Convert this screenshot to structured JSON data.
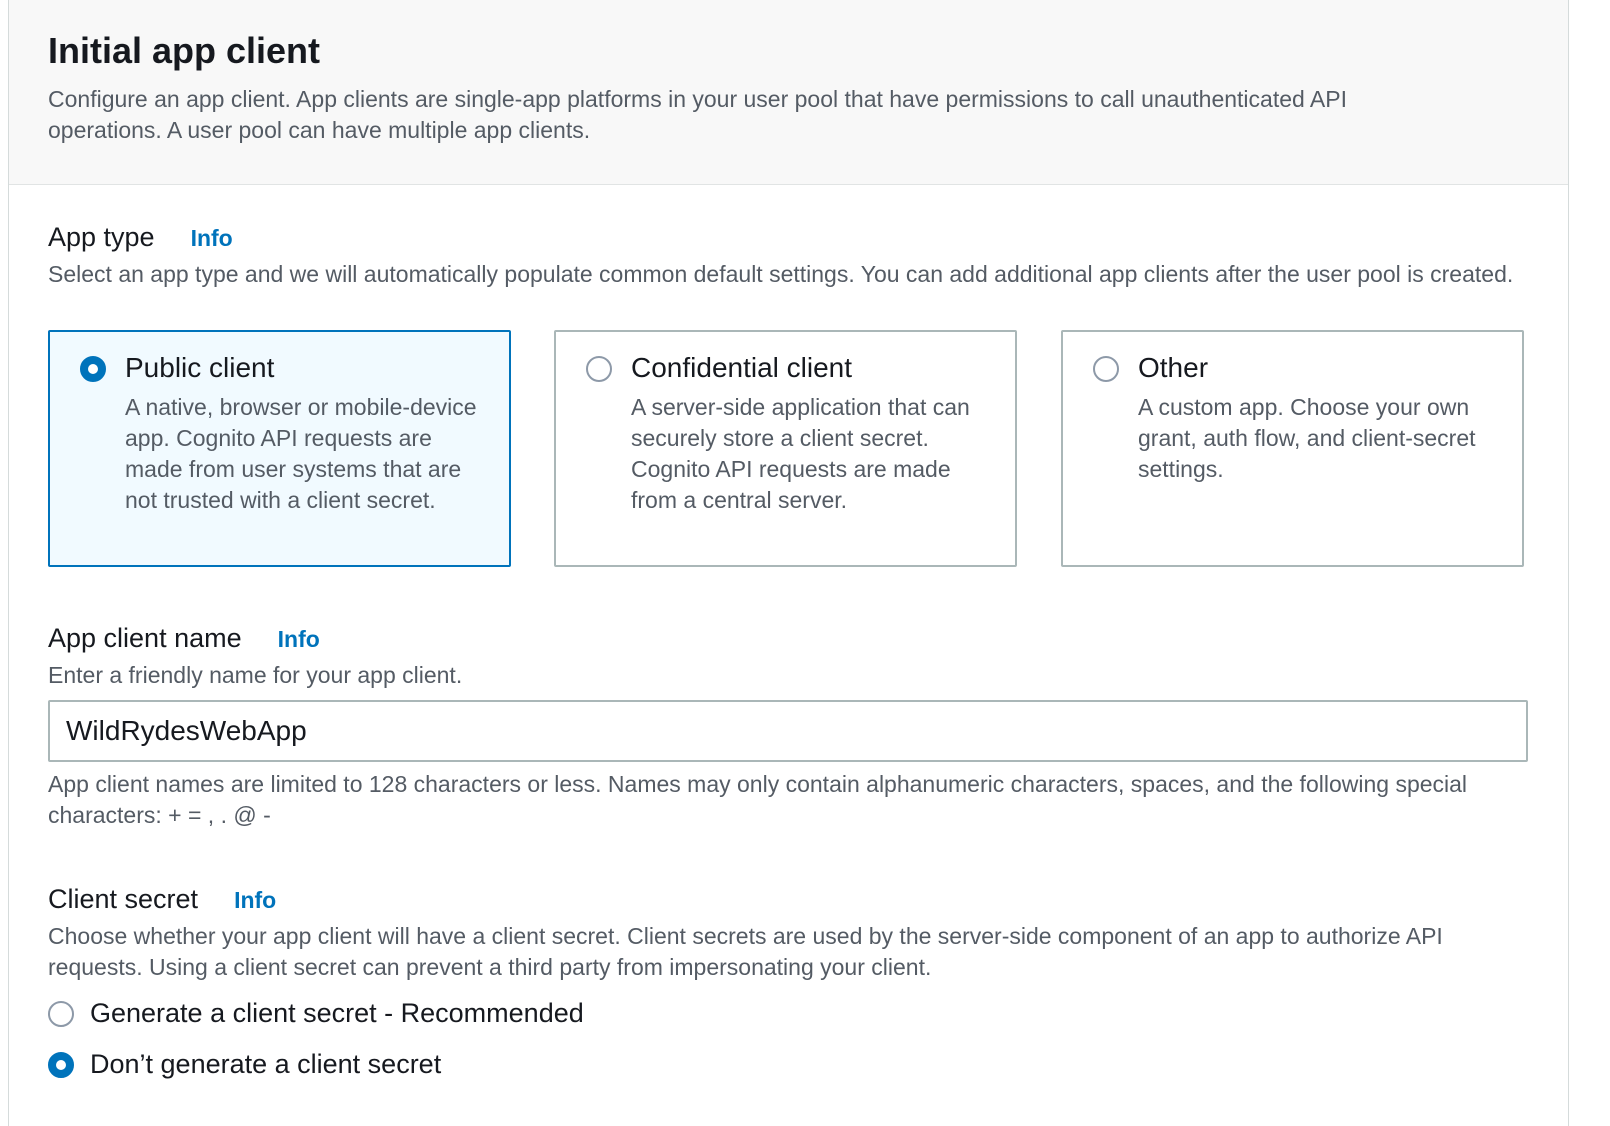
{
  "header": {
    "title": "Initial app client",
    "description": "Configure an app client. App clients are single-app platforms in your user pool that have permissions to call unauthenticated API operations. A user pool can have multiple app clients."
  },
  "app_type": {
    "label": "App type",
    "info": "Info",
    "description": "Select an app type and we will automatically populate common default settings. You can add additional app clients after the user pool is created.",
    "options": [
      {
        "title": "Public client",
        "description": "A native, browser or mobile-device app. Cognito API requests are made from user systems that are not trusted with a client secret.",
        "selected": true
      },
      {
        "title": "Confidential client",
        "description": "A server-side application that can securely store a client secret. Cognito API requests are made from a central server.",
        "selected": false
      },
      {
        "title": "Other",
        "description": "A custom app. Choose your own grant, auth flow, and client-secret settings.",
        "selected": false
      }
    ]
  },
  "app_client_name": {
    "label": "App client name",
    "info": "Info",
    "description": "Enter a friendly name for your app client.",
    "value": "WildRydesWebApp",
    "constraint": "App client names are limited to 128 characters or less. Names may only contain alphanumeric characters, spaces, and the following special characters: + = , . @ -"
  },
  "client_secret": {
    "label": "Client secret",
    "info": "Info",
    "description": "Choose whether your app client will have a client secret. Client secrets are used by the server-side component of an app to authorize API requests. Using a client secret can prevent a third party from impersonating your client.",
    "options": [
      {
        "label": "Generate a client secret - Recommended",
        "selected": false
      },
      {
        "label": "Don’t generate a client secret",
        "selected": true
      }
    ]
  },
  "colors": {
    "accent": "#0073bb",
    "selected_tile_bg": "#f1faff",
    "header_bg": "#f8f8f8",
    "secondary_text": "#545b64"
  }
}
